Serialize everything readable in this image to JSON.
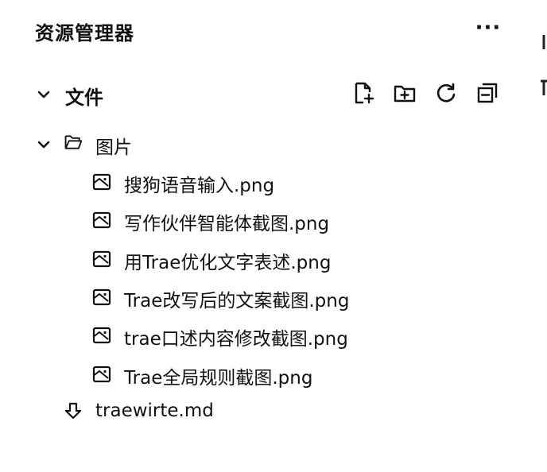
{
  "explorer": {
    "title": "资源管理器",
    "more_label": "···"
  },
  "section": {
    "title": "文件",
    "expanded": true,
    "toolbar": [
      {
        "name": "new-file-button",
        "icon": "new-file-icon"
      },
      {
        "name": "new-folder-button",
        "icon": "new-folder-icon"
      },
      {
        "name": "refresh-button",
        "icon": "refresh-icon"
      },
      {
        "name": "collapse-all-button",
        "icon": "collapse-all-icon"
      }
    ]
  },
  "tree": {
    "folder": {
      "name": "图片",
      "expanded": true,
      "icon": "folder-open-icon",
      "children": [
        {
          "name": "搜狗语音输入.png",
          "icon": "image-file-icon"
        },
        {
          "name": "写作伙伴智能体截图.png",
          "icon": "image-file-icon"
        },
        {
          "name": "用Trae优化文字表述.png",
          "icon": "image-file-icon"
        },
        {
          "name": "Trae改写后的文案截图.png",
          "icon": "image-file-icon"
        },
        {
          "name": "trae口述内容修改截图.png",
          "icon": "image-file-icon"
        },
        {
          "name": "Trae全局规则截图.png",
          "icon": "image-file-icon"
        }
      ]
    },
    "file": {
      "name": "traewirte.md",
      "icon": "markdown-file-icon"
    }
  }
}
